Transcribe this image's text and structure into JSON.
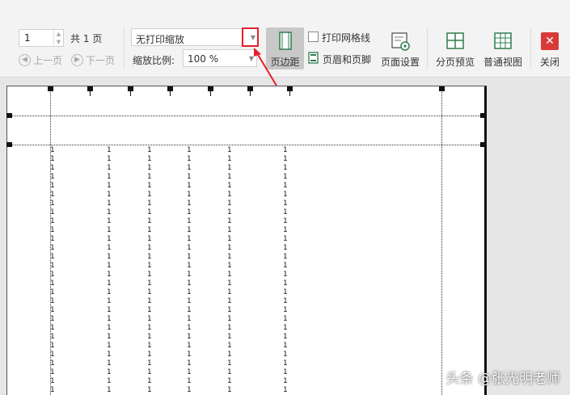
{
  "toolbar": {
    "page_value": "1",
    "total_pages": "共 1 页",
    "prev_page": "上一页",
    "next_page": "下一页",
    "scaling_value": "无打印缩放",
    "zoom_label": "缩放比例:",
    "zoom_value": "100 %",
    "margins_label": "页边距",
    "print_gridlines_label": "打印网格线",
    "header_footer_label": "页眉和页脚",
    "page_setup_label": "页面设置",
    "page_break_preview_label": "分页预览",
    "normal_view_label": "普通视图",
    "close_label": "关闭"
  },
  "sheet": {
    "cell_value": "1",
    "row_count": 30
  },
  "watermark": "头条 @张光明老师",
  "colors": {
    "accent_red": "#e5202b",
    "toolbar_bg": "#f3f3f3",
    "workspace_bg": "#e6e6e6",
    "close_red": "#d83a3a",
    "active_button": "#c8c8c8"
  },
  "icons": {
    "page_spinner": "spinner-icon",
    "prev": "left-arrow-circle-icon",
    "next": "right-arrow-circle-icon",
    "margins": "page-margins-icon",
    "header_footer": "header-footer-icon",
    "page_setup": "page-setup-icon",
    "page_break": "page-break-preview-icon",
    "normal_view": "normal-view-grid-icon",
    "close": "close-x-icon"
  }
}
